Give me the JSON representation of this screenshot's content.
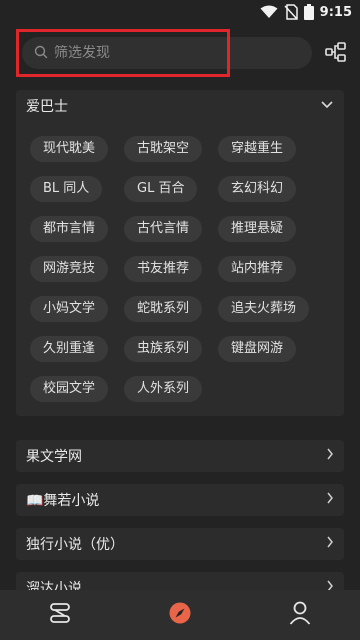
{
  "status_bar": {
    "time": "9:15"
  },
  "search": {
    "placeholder": "筛选发现"
  },
  "section": {
    "title": "爱巴士",
    "tags": [
      "现代耽美",
      "古耽架空",
      "穿越重生",
      "BL 同人",
      "GL 百合",
      "玄幻科幻",
      "都市言情",
      "古代言情",
      "推理悬疑",
      "网游竞技",
      "书友推荐",
      "站内推荐",
      "小妈文学",
      "蛇耽系列",
      "追夫火葬场",
      "久别重逢",
      "虫族系列",
      "键盘网游",
      "校园文学",
      "人外系列"
    ]
  },
  "sites": [
    {
      "label": "果文学网"
    },
    {
      "label": "📖舞若小说"
    },
    {
      "label": "独行小说（优）"
    },
    {
      "label": "溜达小说"
    }
  ],
  "colors": {
    "background": "#232323",
    "card": "#2c2c2c",
    "tag": "#3a3a3a",
    "accent": "#e8654a",
    "highlight": "#e0252b"
  },
  "bottom_nav": {
    "items": [
      {
        "icon": "bookshelf-icon"
      },
      {
        "icon": "compass-icon",
        "active": true
      },
      {
        "icon": "person-icon"
      }
    ]
  }
}
